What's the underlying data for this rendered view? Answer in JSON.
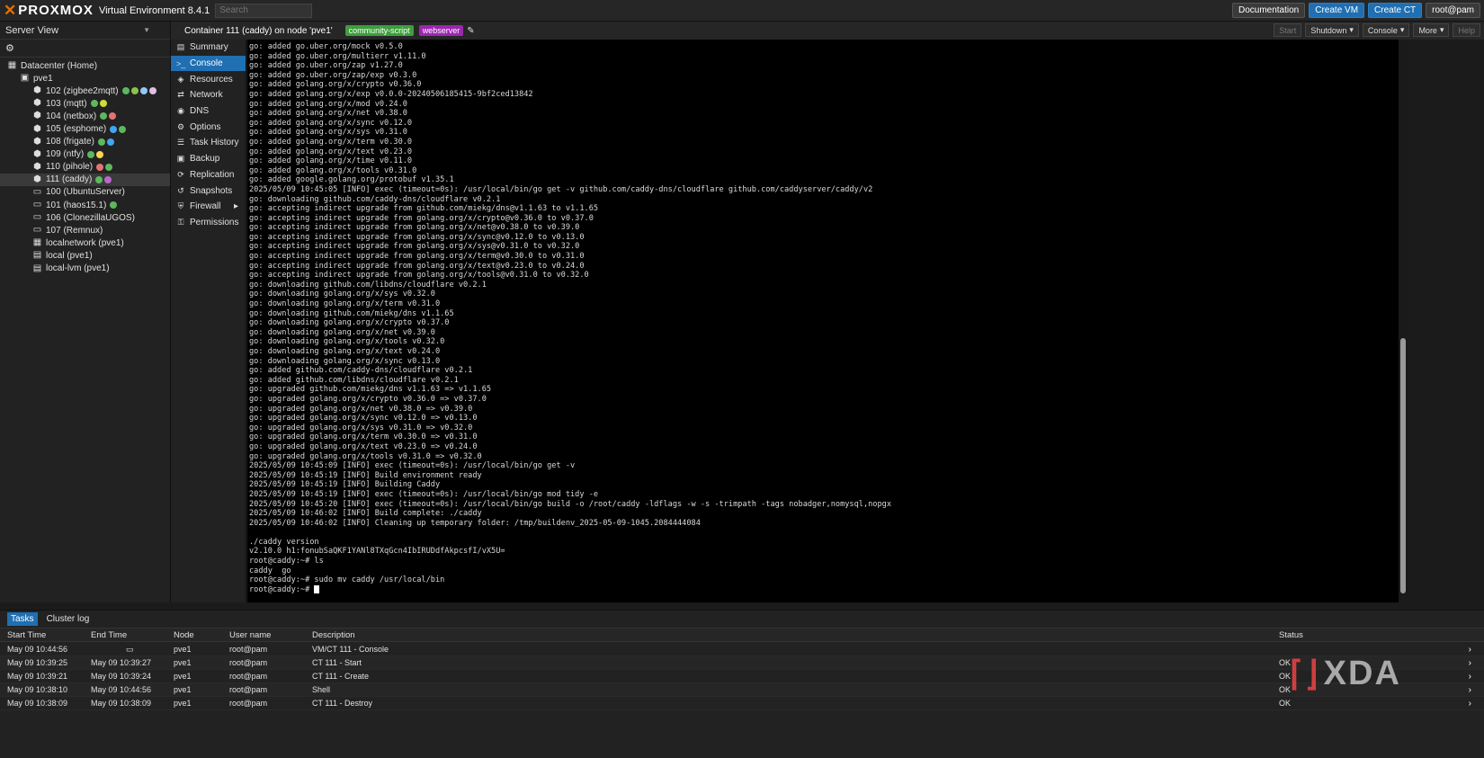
{
  "topbar": {
    "brand": "PROXMOX",
    "version": "Virtual Environment 8.4.1",
    "search_placeholder": "Search",
    "buttons": [
      "Documentation",
      "Create VM",
      "Create CT",
      "root@pam"
    ]
  },
  "left": {
    "view": "Server View",
    "tree": [
      {
        "label": "Datacenter (Home)",
        "indent": 0,
        "icon": "datacenter-icon",
        "dots": []
      },
      {
        "label": "pve1",
        "indent": 1,
        "icon": "node-icon",
        "dots": []
      },
      {
        "label": "102 (zigbee2mqtt)",
        "indent": 2,
        "icon": "ct-icon",
        "dots": [
          "#5cb85c",
          "#8bc34a",
          "#90caf9",
          "#e1bee7"
        ]
      },
      {
        "label": "103 (mqtt)",
        "indent": 2,
        "icon": "ct-icon",
        "dots": [
          "#5cb85c",
          "#cddc39"
        ]
      },
      {
        "label": "104 (netbox)",
        "indent": 2,
        "icon": "ct-icon",
        "dots": [
          "#5cb85c",
          "#e57373"
        ]
      },
      {
        "label": "105 (esphome)",
        "indent": 2,
        "icon": "ct-icon",
        "dots": [
          "#42a5f5",
          "#5cb85c"
        ]
      },
      {
        "label": "108 (frigate)",
        "indent": 2,
        "icon": "ct-icon",
        "dots": [
          "#5cb85c",
          "#42a5f5"
        ]
      },
      {
        "label": "109 (ntfy)",
        "indent": 2,
        "icon": "ct-icon",
        "dots": [
          "#5cb85c",
          "#ffd54f"
        ]
      },
      {
        "label": "110 (pihole)",
        "indent": 2,
        "icon": "ct-icon",
        "dots": [
          "#e57373",
          "#5cb85c"
        ]
      },
      {
        "label": "111 (caddy)",
        "indent": 2,
        "icon": "ct-icon",
        "dots": [
          "#5cb85c",
          "#ba68c8"
        ],
        "selected": true
      },
      {
        "label": "100 (UbuntuServer)",
        "indent": 2,
        "icon": "vm-icon",
        "dots": []
      },
      {
        "label": "101 (haos15.1)",
        "indent": 2,
        "icon": "vm-icon",
        "dots": [
          "#5cb85c"
        ]
      },
      {
        "label": "106 (ClonezillaUGOS)",
        "indent": 2,
        "icon": "vm-icon",
        "dots": []
      },
      {
        "label": "107 (Remnux)",
        "indent": 2,
        "icon": "vm-icon",
        "dots": []
      },
      {
        "label": "localnetwork (pve1)",
        "indent": 2,
        "icon": "network-icon",
        "dots": []
      },
      {
        "label": "local (pve1)",
        "indent": 2,
        "icon": "storage-icon",
        "dots": []
      },
      {
        "label": "local-lvm (pve1)",
        "indent": 2,
        "icon": "storage-icon",
        "dots": []
      }
    ]
  },
  "header": {
    "title": "Container 111 (caddy) on node 'pve1'",
    "tags": [
      {
        "label": "community-script",
        "color": "#3c9f3c"
      },
      {
        "label": "webserver",
        "color": "#9c27b0"
      }
    ],
    "buttons": [
      {
        "label": "Start",
        "dim": true
      },
      {
        "label": "Shutdown"
      },
      {
        "label": "Console"
      },
      {
        "label": "More"
      },
      {
        "label": "Help",
        "dim": true
      }
    ]
  },
  "menu": [
    {
      "label": "Summary",
      "icon": "summary-icon",
      "glyph": "▤"
    },
    {
      "label": "Console",
      "icon": "console-icon",
      "glyph": ">_",
      "active": true
    },
    {
      "label": "Resources",
      "icon": "resources-icon",
      "glyph": "◈"
    },
    {
      "label": "Network",
      "icon": "network-icon",
      "glyph": "⇄"
    },
    {
      "label": "DNS",
      "icon": "dns-icon",
      "glyph": "◉"
    },
    {
      "label": "Options",
      "icon": "options-icon",
      "glyph": "⚙"
    },
    {
      "label": "Task History",
      "icon": "task-history-icon",
      "glyph": "☰"
    },
    {
      "label": "Backup",
      "icon": "backup-icon",
      "glyph": "▣"
    },
    {
      "label": "Replication",
      "icon": "replication-icon",
      "glyph": "⟳"
    },
    {
      "label": "Snapshots",
      "icon": "snapshots-icon",
      "glyph": "↺"
    },
    {
      "label": "Firewall",
      "icon": "firewall-icon",
      "glyph": "⛨",
      "sub": true
    },
    {
      "label": "Permissions",
      "icon": "permissions-icon",
      "glyph": "⚿"
    }
  ],
  "console": [
    "go: added go.uber.org/mock v0.5.0",
    "go: added go.uber.org/multierr v1.11.0",
    "go: added go.uber.org/zap v1.27.0",
    "go: added go.uber.org/zap/exp v0.3.0",
    "go: added golang.org/x/crypto v0.36.0",
    "go: added golang.org/x/exp v0.0.0-20240506185415-9bf2ced13842",
    "go: added golang.org/x/mod v0.24.0",
    "go: added golang.org/x/net v0.38.0",
    "go: added golang.org/x/sync v0.12.0",
    "go: added golang.org/x/sys v0.31.0",
    "go: added golang.org/x/term v0.30.0",
    "go: added golang.org/x/text v0.23.0",
    "go: added golang.org/x/time v0.11.0",
    "go: added golang.org/x/tools v0.31.0",
    "go: added google.golang.org/protobuf v1.35.1",
    "2025/05/09 10:45:05 [INFO] exec (timeout=0s): /usr/local/bin/go get -v github.com/caddy-dns/cloudflare github.com/caddyserver/caddy/v2",
    "go: downloading github.com/caddy-dns/cloudflare v0.2.1",
    "go: accepting indirect upgrade from github.com/miekg/dns@v1.1.63 to v1.1.65",
    "go: accepting indirect upgrade from golang.org/x/crypto@v0.36.0 to v0.37.0",
    "go: accepting indirect upgrade from golang.org/x/net@v0.38.0 to v0.39.0",
    "go: accepting indirect upgrade from golang.org/x/sync@v0.12.0 to v0.13.0",
    "go: accepting indirect upgrade from golang.org/x/sys@v0.31.0 to v0.32.0",
    "go: accepting indirect upgrade from golang.org/x/term@v0.30.0 to v0.31.0",
    "go: accepting indirect upgrade from golang.org/x/text@v0.23.0 to v0.24.0",
    "go: accepting indirect upgrade from golang.org/x/tools@v0.31.0 to v0.32.0",
    "go: downloading github.com/libdns/cloudflare v0.2.1",
    "go: downloading golang.org/x/sys v0.32.0",
    "go: downloading golang.org/x/term v0.31.0",
    "go: downloading github.com/miekg/dns v1.1.65",
    "go: downloading golang.org/x/crypto v0.37.0",
    "go: downloading golang.org/x/net v0.39.0",
    "go: downloading golang.org/x/tools v0.32.0",
    "go: downloading golang.org/x/text v0.24.0",
    "go: downloading golang.org/x/sync v0.13.0",
    "go: added github.com/caddy-dns/cloudflare v0.2.1",
    "go: added github.com/libdns/cloudflare v0.2.1",
    "go: upgraded github.com/miekg/dns v1.1.63 => v1.1.65",
    "go: upgraded golang.org/x/crypto v0.36.0 => v0.37.0",
    "go: upgraded golang.org/x/net v0.38.0 => v0.39.0",
    "go: upgraded golang.org/x/sync v0.12.0 => v0.13.0",
    "go: upgraded golang.org/x/sys v0.31.0 => v0.32.0",
    "go: upgraded golang.org/x/term v0.30.0 => v0.31.0",
    "go: upgraded golang.org/x/text v0.23.0 => v0.24.0",
    "go: upgraded golang.org/x/tools v0.31.0 => v0.32.0",
    "2025/05/09 10:45:09 [INFO] exec (timeout=0s): /usr/local/bin/go get -v",
    "2025/05/09 10:45:19 [INFO] Build environment ready",
    "2025/05/09 10:45:19 [INFO] Building Caddy",
    "2025/05/09 10:45:19 [INFO] exec (timeout=0s): /usr/local/bin/go mod tidy -e",
    "2025/05/09 10:45:20 [INFO] exec (timeout=0s): /usr/local/bin/go build -o /root/caddy -ldflags -w -s -trimpath -tags nobadger,nomysql,nopgx",
    "2025/05/09 10:46:02 [INFO] Build complete: ./caddy",
    "2025/05/09 10:46:02 [INFO] Cleaning up temporary folder: /tmp/buildenv_2025-05-09-1045.2084444084",
    "",
    "./caddy version",
    "v2.10.0 h1:fonubSaQKF1YANl8TXqGcn4IbIRUDdfAkpcsfI/vX5U=",
    "root@caddy:~# ls",
    "caddy  go",
    "root@caddy:~# sudo mv caddy /usr/local/bin",
    "root@caddy:~# "
  ],
  "bottom": {
    "tabs": [
      "Tasks",
      "Cluster log"
    ],
    "columns": [
      "Start Time",
      "End Time",
      "Node",
      "User name",
      "Description",
      "Status"
    ],
    "rows": [
      [
        "May 09 10:44:56",
        "",
        "pve1",
        "root@pam",
        "VM/CT 111 - Console",
        ""
      ],
      [
        "May 09 10:39:25",
        "May 09 10:39:27",
        "pve1",
        "root@pam",
        "CT 111 - Start",
        "OK"
      ],
      [
        "May 09 10:39:21",
        "May 09 10:39:24",
        "pve1",
        "root@pam",
        "CT 111 - Create",
        "OK"
      ],
      [
        "May 09 10:38:10",
        "May 09 10:44:56",
        "pve1",
        "root@pam",
        "Shell",
        "OK"
      ],
      [
        "May 09 10:38:09",
        "May 09 10:38:09",
        "pve1",
        "root@pam",
        "CT 111 - Destroy",
        "OK"
      ]
    ]
  },
  "watermark": "XDA"
}
